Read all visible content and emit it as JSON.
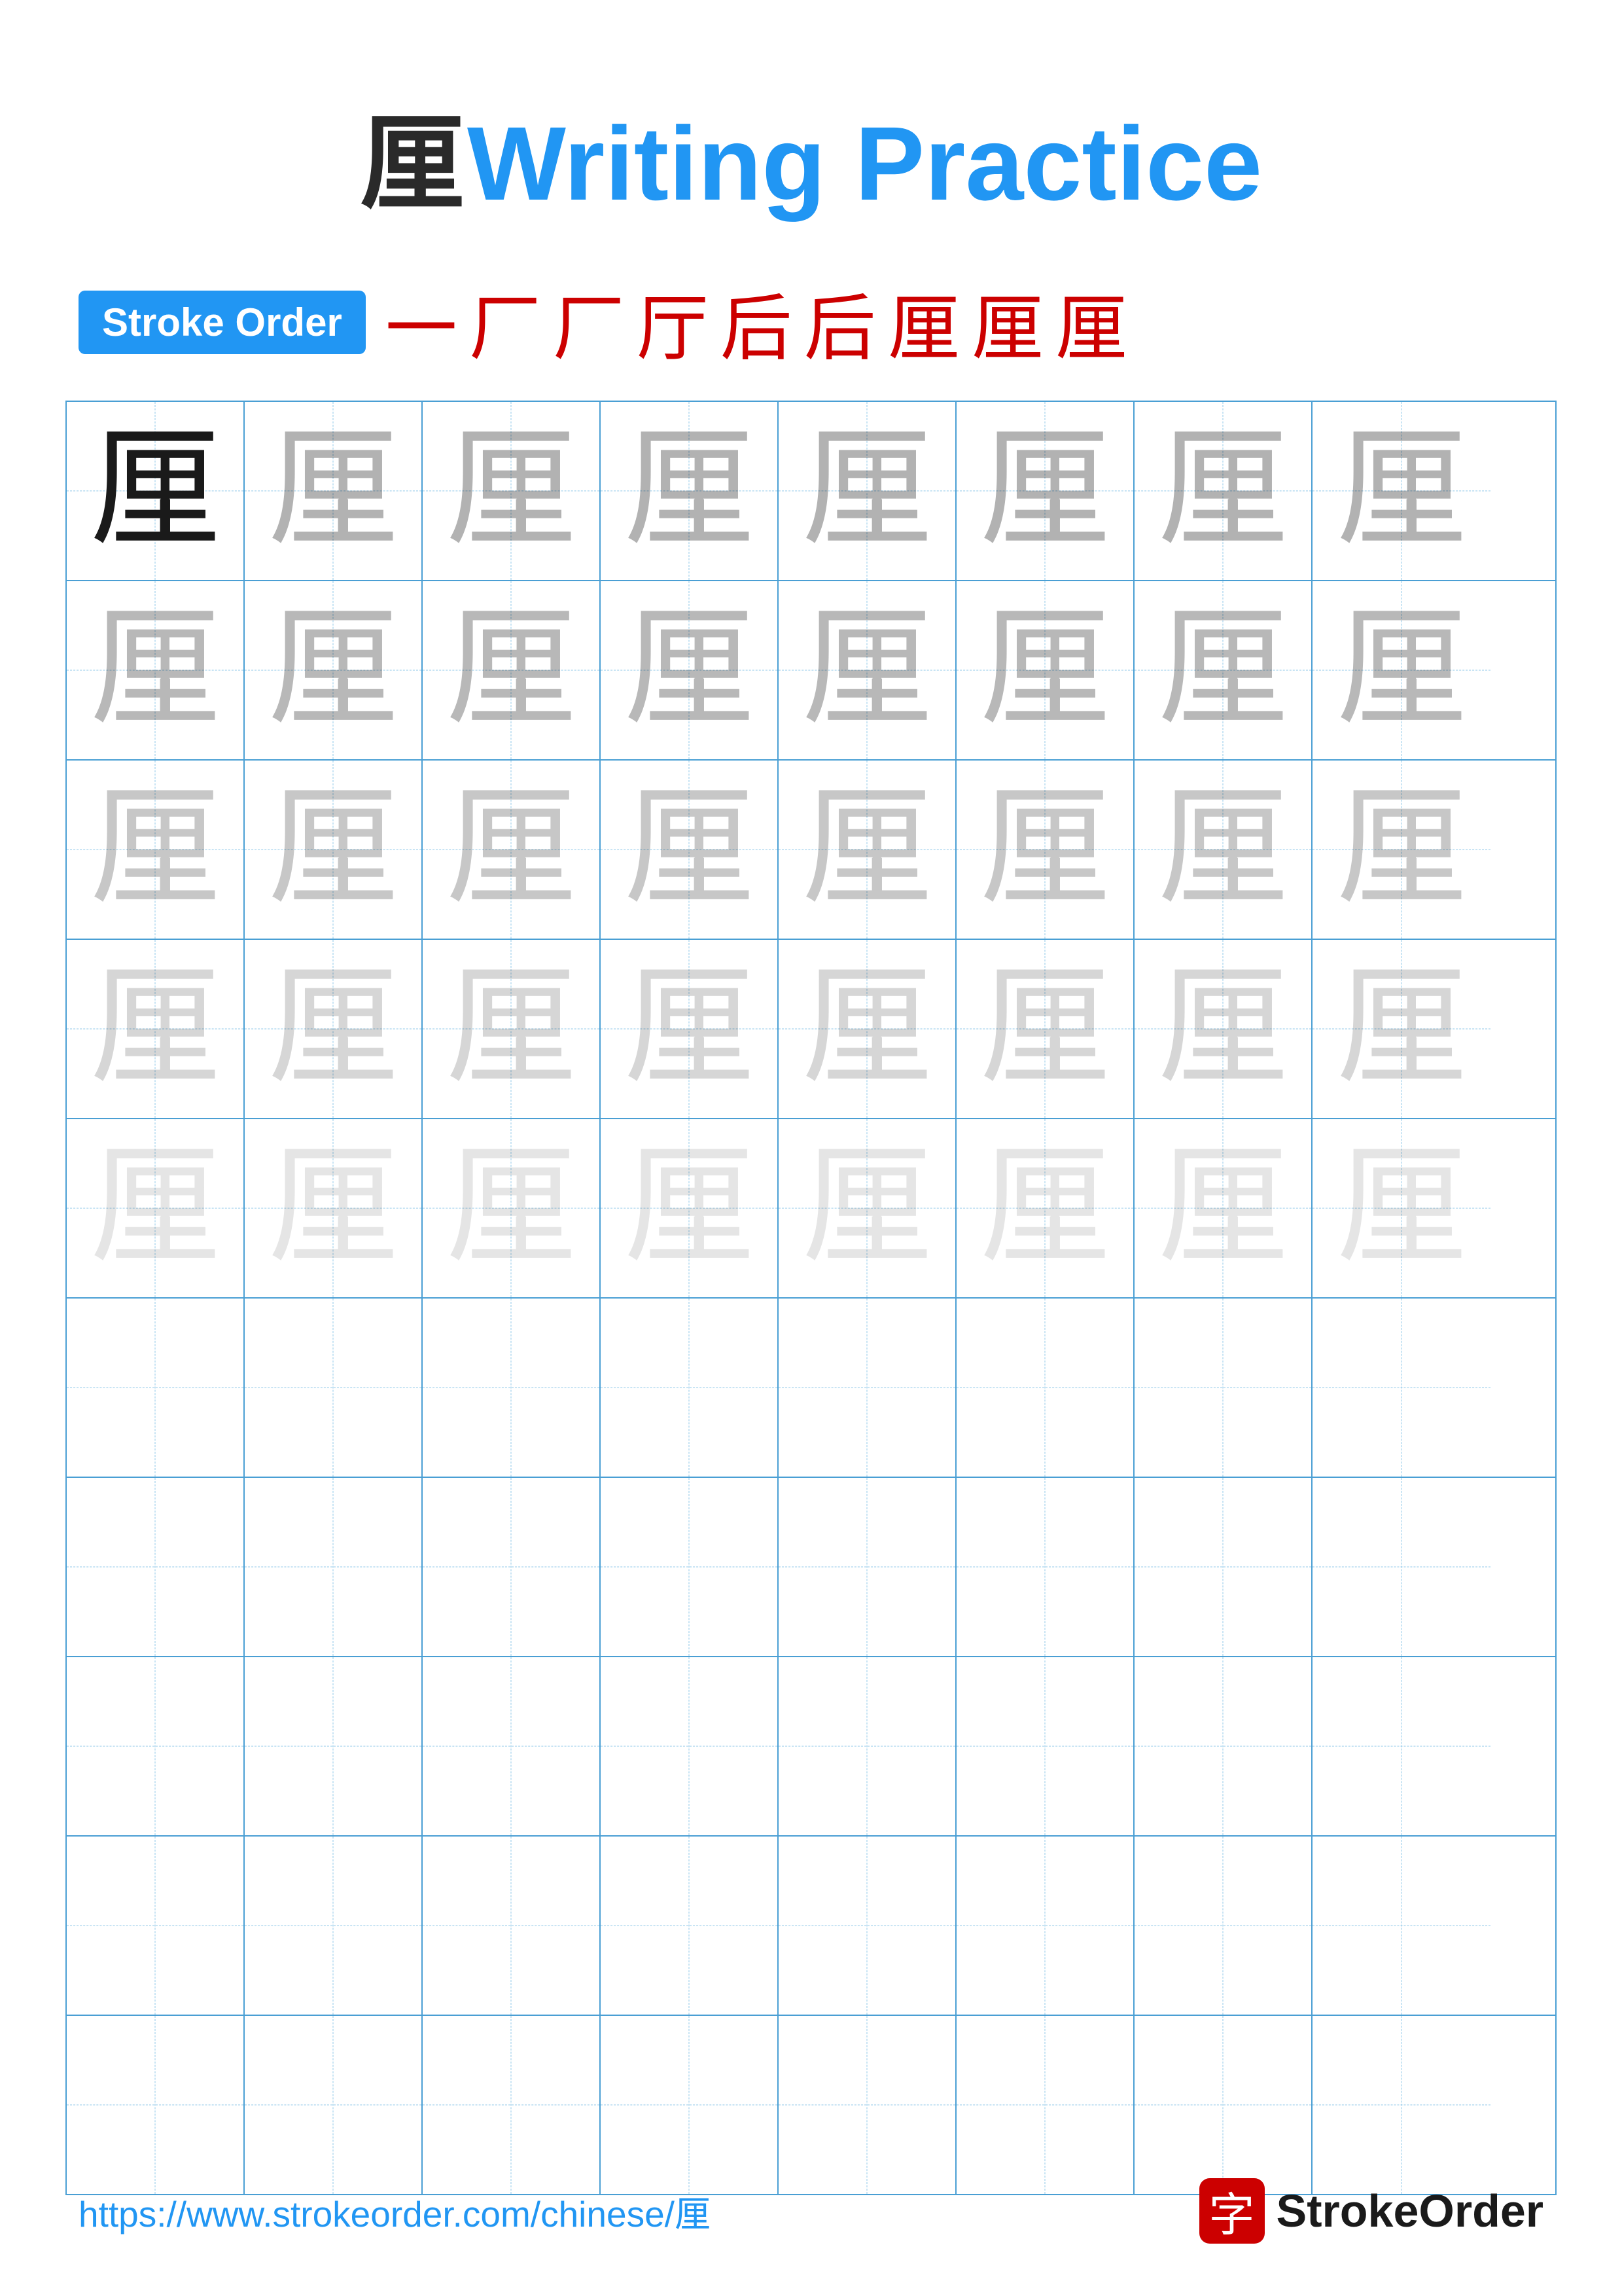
{
  "title": {
    "char": "厘",
    "writing_practice_label": "Writing Practice"
  },
  "stroke_order": {
    "badge_label": "Stroke Order",
    "strokes": [
      "一",
      "厂",
      "厂",
      "厅",
      "后",
      "后",
      "厘",
      "厘",
      "厘"
    ]
  },
  "grid": {
    "rows": 10,
    "cols": 8,
    "char": "厘",
    "filled_rows": 5,
    "opacity_levels": [
      "solid",
      "1",
      "1",
      "2",
      "2",
      "3",
      "3",
      "4",
      "4",
      "empty"
    ]
  },
  "footer": {
    "url": "https://www.strokeorder.com/chinese/厘",
    "brand_icon": "字",
    "brand_name": "StrokeOrder"
  }
}
